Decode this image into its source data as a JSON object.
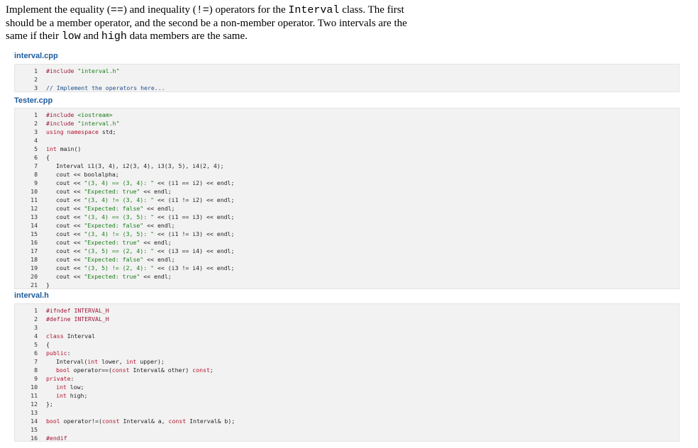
{
  "prompt": {
    "s1": "Implement the equality (",
    "eq_op": "==",
    "s2": ") and inequality (",
    "neq_op": "!=",
    "s3": ") operators for the ",
    "cls": "Interval",
    "s4": " class. The first should be a member operator, and the second be a non-member operator. Two intervals are the same if their ",
    "low": "low",
    "s5": " and ",
    "high": "high",
    "s6": " data members are the same."
  },
  "files": {
    "interval_cpp": {
      "name": "interval.cpp",
      "lines": [
        {
          "n": "1",
          "t": "#include \"interval.h\""
        },
        {
          "n": "2",
          "t": ""
        },
        {
          "n": "3",
          "t": "// Implement the operators here..."
        }
      ]
    },
    "tester_cpp": {
      "name": "Tester.cpp",
      "lines": [
        {
          "n": "1",
          "t": "#include <iostream>"
        },
        {
          "n": "2",
          "t": "#include \"interval.h\""
        },
        {
          "n": "3",
          "t": "using namespace std;"
        },
        {
          "n": "4",
          "t": ""
        },
        {
          "n": "5",
          "t": "int main()"
        },
        {
          "n": "6",
          "t": "{"
        },
        {
          "n": "7",
          "t": "Interval i1(3, 4), i2(3, 4), i3(3, 5), i4(2, 4);"
        },
        {
          "n": "8",
          "t": "cout << boolalpha;"
        },
        {
          "n": "9",
          "t": "cout << \"(3, 4) == (3, 4): \" << (i1 == i2) << endl;"
        },
        {
          "n": "10",
          "t": "cout << \"Expected: true\" << endl;"
        },
        {
          "n": "11",
          "t": "cout << \"(3, 4) != (3, 4): \" << (i1 != i2) << endl;"
        },
        {
          "n": "12",
          "t": "cout << \"Expected: false\" << endl;"
        },
        {
          "n": "13",
          "t": "cout << \"(3, 4) == (3, 5): \" << (i1 == i3) << endl;"
        },
        {
          "n": "14",
          "t": "cout << \"Expected: false\" << endl;"
        },
        {
          "n": "15",
          "t": "cout << \"(3, 4) != (3, 5): \" << (i1 != i3) << endl;"
        },
        {
          "n": "16",
          "t": "cout << \"Expected: true\" << endl;"
        },
        {
          "n": "17",
          "t": "cout << \"(3, 5) == (2, 4): \" << (i3 == i4) << endl;"
        },
        {
          "n": "18",
          "t": "cout << \"Expected: false\" << endl;"
        },
        {
          "n": "19",
          "t": "cout << \"(3, 5) != (2, 4): \" << (i3 != i4) << endl;"
        },
        {
          "n": "20",
          "t": "cout << \"Expected: true\" << endl;"
        },
        {
          "n": "21",
          "t": "}"
        }
      ]
    },
    "interval_h": {
      "name": "interval.h",
      "lines": [
        {
          "n": "1",
          "t": "#ifndef INTERVAL_H"
        },
        {
          "n": "2",
          "t": "#define INTERVAL_H"
        },
        {
          "n": "3",
          "t": ""
        },
        {
          "n": "4",
          "t": "class Interval"
        },
        {
          "n": "5",
          "t": "{"
        },
        {
          "n": "6",
          "t": "public:"
        },
        {
          "n": "7",
          "t": "Interval(int lower, int upper);"
        },
        {
          "n": "8",
          "t": "bool operator==(const Interval& other) const;"
        },
        {
          "n": "9",
          "t": "private:"
        },
        {
          "n": "10",
          "t": "int low;"
        },
        {
          "n": "11",
          "t": "int high;"
        },
        {
          "n": "12",
          "t": "};"
        },
        {
          "n": "13",
          "t": ""
        },
        {
          "n": "14",
          "t": "bool operator!=(const Interval& a, const Interval& b);"
        },
        {
          "n": "15",
          "t": ""
        },
        {
          "n": "16",
          "t": "#endif"
        }
      ]
    }
  },
  "colors": {
    "filename": "#1d5b9e",
    "code_bg": "#f2f2f2",
    "preprocessor": "#a01538",
    "string": "#1a7f1a",
    "keyword": "#b5142f",
    "comment": "#1f4e8a"
  }
}
